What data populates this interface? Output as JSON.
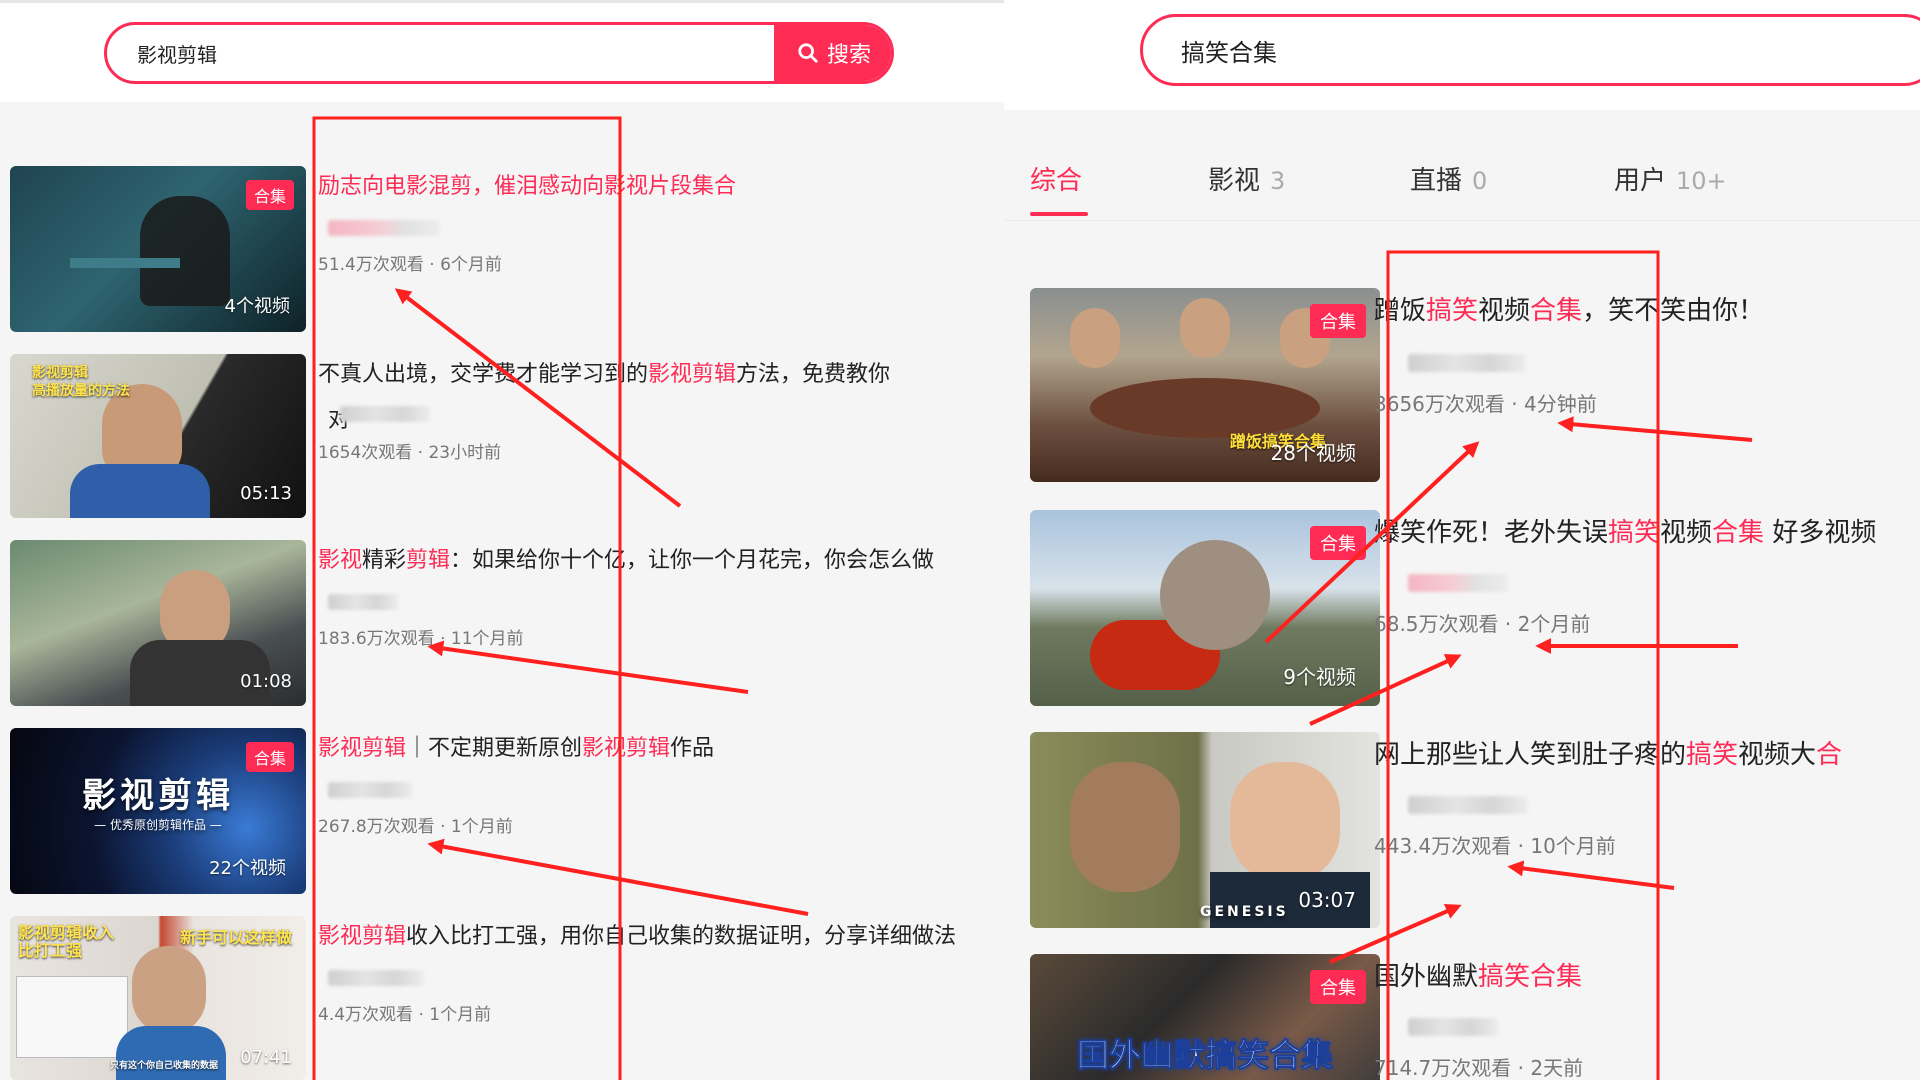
{
  "left": {
    "search": {
      "query": "影视剪辑",
      "button_label": "搜索"
    },
    "results": [
      {
        "title": [
          {
            "t": "励志向电影混剪，催泪感动向影视片段集合",
            "h": true
          }
        ],
        "views": "51.4万次观看",
        "time": "6个月前",
        "badge": "合集",
        "thumb_label": "4个视频"
      },
      {
        "title": [
          {
            "t": "不真人出境，交学费才能学习到的",
            "h": false
          },
          {
            "t": "影视剪辑",
            "h": true
          },
          {
            "t": "方法，免费教你",
            "h": false
          }
        ],
        "title_line2": "对",
        "views": "1654次观看",
        "time": "23小时前",
        "thumb_label": "05:13",
        "thumb_text": "影视剪辑\n高播放量的方法"
      },
      {
        "title": [
          {
            "t": "影视",
            "h": true
          },
          {
            "t": "精彩",
            "h": false
          },
          {
            "t": "剪辑",
            "h": true
          },
          {
            "t": "：如果给你十个亿，让你一个月花完，你会怎么做",
            "h": false
          }
        ],
        "views": "183.6万次观看",
        "time": "11个月前",
        "thumb_label": "01:08"
      },
      {
        "title": [
          {
            "t": "影视剪辑",
            "h": true
          },
          {
            "t": "｜不定期更新原创",
            "h": false
          },
          {
            "t": "影视剪辑",
            "h": true
          },
          {
            "t": "作品",
            "h": false
          }
        ],
        "views": "267.8万次观看",
        "time": "1个月前",
        "badge": "合集",
        "thumb_label": "22个视频",
        "thumb_text": "影视剪辑",
        "thumb_sub": "— 优秀原创剪辑作品 —"
      },
      {
        "title": [
          {
            "t": "影视剪辑",
            "h": true
          },
          {
            "t": "收入比打工强，用你自己收集的数据证明，分享详细做法",
            "h": false
          }
        ],
        "views": "4.4万次观看",
        "time": "1个月前",
        "thumb_label": "07:41",
        "thumb_text_a": "影视剪辑收入\n比打工强",
        "thumb_text_b": "新手可以这样做",
        "thumb_footer": "只有这个你自己收集的数据"
      }
    ]
  },
  "right": {
    "search": {
      "query": "搞笑合集"
    },
    "tabs": [
      {
        "label": "综合",
        "count": ""
      },
      {
        "label": "影视",
        "count": "3"
      },
      {
        "label": "直播",
        "count": "0"
      },
      {
        "label": "用户",
        "count": "10+"
      }
    ],
    "results": [
      {
        "title": [
          {
            "t": "蹭饭",
            "h": false
          },
          {
            "t": "搞笑",
            "h": true
          },
          {
            "t": "视频",
            "h": false
          },
          {
            "t": "合集",
            "h": true
          },
          {
            "t": "，笑不笑由你！",
            "h": false
          }
        ],
        "views": "3656万次观看",
        "time": "4分钟前",
        "badge": "合集",
        "thumb_label": "28个视频",
        "thumb_text": "蹭饭搞笑合集"
      },
      {
        "title": [
          {
            "t": "爆笑作死！老外失误",
            "h": false
          },
          {
            "t": "搞笑",
            "h": true
          },
          {
            "t": "视频",
            "h": false
          },
          {
            "t": "合集",
            "h": true
          },
          {
            "t": " 好多视频",
            "h": false
          }
        ],
        "views": "68.5万次观看",
        "time": "2个月前",
        "badge": "合集",
        "thumb_label": "9个视频"
      },
      {
        "title": [
          {
            "t": "网上那些让人笑到肚子疼的",
            "h": false
          },
          {
            "t": "搞笑",
            "h": true
          },
          {
            "t": "视频大",
            "h": false
          },
          {
            "t": "合",
            "h": true
          }
        ],
        "views": "443.4万次观看",
        "time": "10个月前",
        "thumb_label": "03:07",
        "thumb_text": "GENESIS"
      },
      {
        "title": [
          {
            "t": "国外幽默",
            "h": false
          },
          {
            "t": "搞笑合集",
            "h": true
          }
        ],
        "views": "714.7万次观看",
        "time": "2天前",
        "badge": "合集",
        "thumb_text": "国外幽默搞笑合集"
      }
    ]
  },
  "colors": {
    "accent": "#fe2c55",
    "annotation": "#ff2020"
  },
  "icons": {
    "search_button": "search-icon"
  }
}
